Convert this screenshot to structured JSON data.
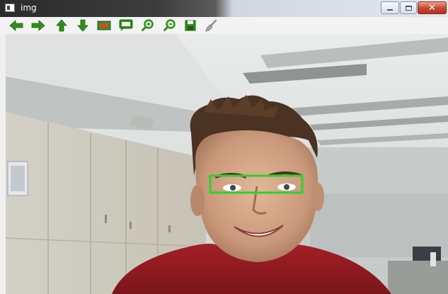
{
  "window": {
    "title": "img",
    "close_glyph": "✕"
  },
  "toolbar": {
    "buttons": [
      {
        "name": "pan-left-icon"
      },
      {
        "name": "pan-right-icon"
      },
      {
        "name": "pan-up-icon"
      },
      {
        "name": "pan-down-icon"
      },
      {
        "name": "zoom-to-fit-icon"
      },
      {
        "name": "zoom-to-pixel-icon"
      },
      {
        "name": "zoom-in-icon"
      },
      {
        "name": "zoom-out-icon"
      },
      {
        "name": "save-icon"
      },
      {
        "name": "properties-icon"
      }
    ]
  },
  "colors": {
    "toolbar_green": "#2f8f1a",
    "detection_box": "#2ed12e",
    "shirt_red": "#9e1f24"
  },
  "detection": {
    "label": "eyes-detection-box"
  }
}
